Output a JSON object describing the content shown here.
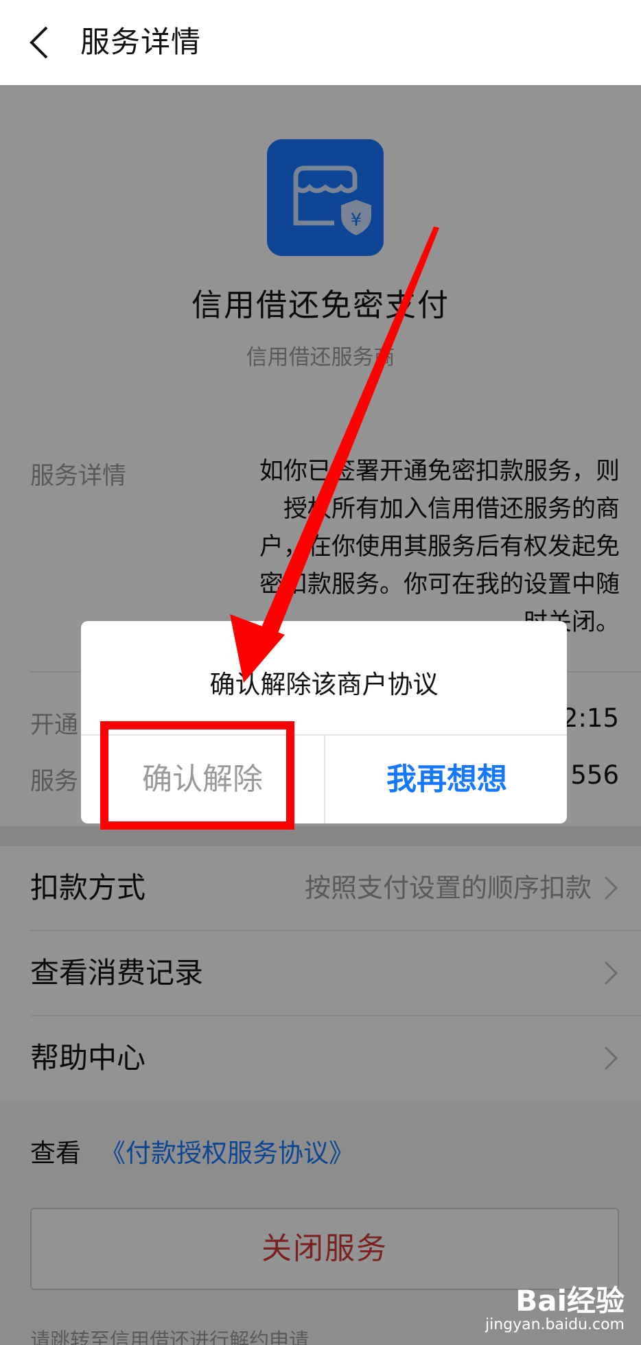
{
  "header": {
    "title": "服务详情"
  },
  "service": {
    "name": "信用借还免密支付",
    "provider": "信用借还服务商",
    "detail_label": "服务详情",
    "detail_lines": [
      "如你已签署开通免密扣款服务，则",
      "授权所有加入信用借还服务的商",
      "户，在你使用其服务后有权发起免",
      "密扣款服务。你可在我的设置中随",
      "时关闭。"
    ],
    "open_label": "开通",
    "open_value": "2:15",
    "service_no_label": "服务",
    "service_no_value": "556"
  },
  "list": {
    "items": [
      {
        "label": "扣款方式",
        "value": "按照支付设置的顺序扣款"
      },
      {
        "label": "查看消费记录",
        "value": ""
      },
      {
        "label": "帮助中心",
        "value": ""
      }
    ]
  },
  "agreement": {
    "prefix": "查看",
    "link": "《付款授权服务协议》"
  },
  "close_button": "关闭服务",
  "bottom_note": "请跳转至信用借还进行解约申请",
  "dialog": {
    "title": "确认解除该商户协议",
    "confirm": "确认解除",
    "cancel": "我再想想"
  },
  "watermark": {
    "brand": "Bai经验",
    "url": "jingyan.baidu.com"
  },
  "colors": {
    "accent": "#1677ff",
    "danger": "#d23a3a",
    "annotation": "#ff0000"
  }
}
